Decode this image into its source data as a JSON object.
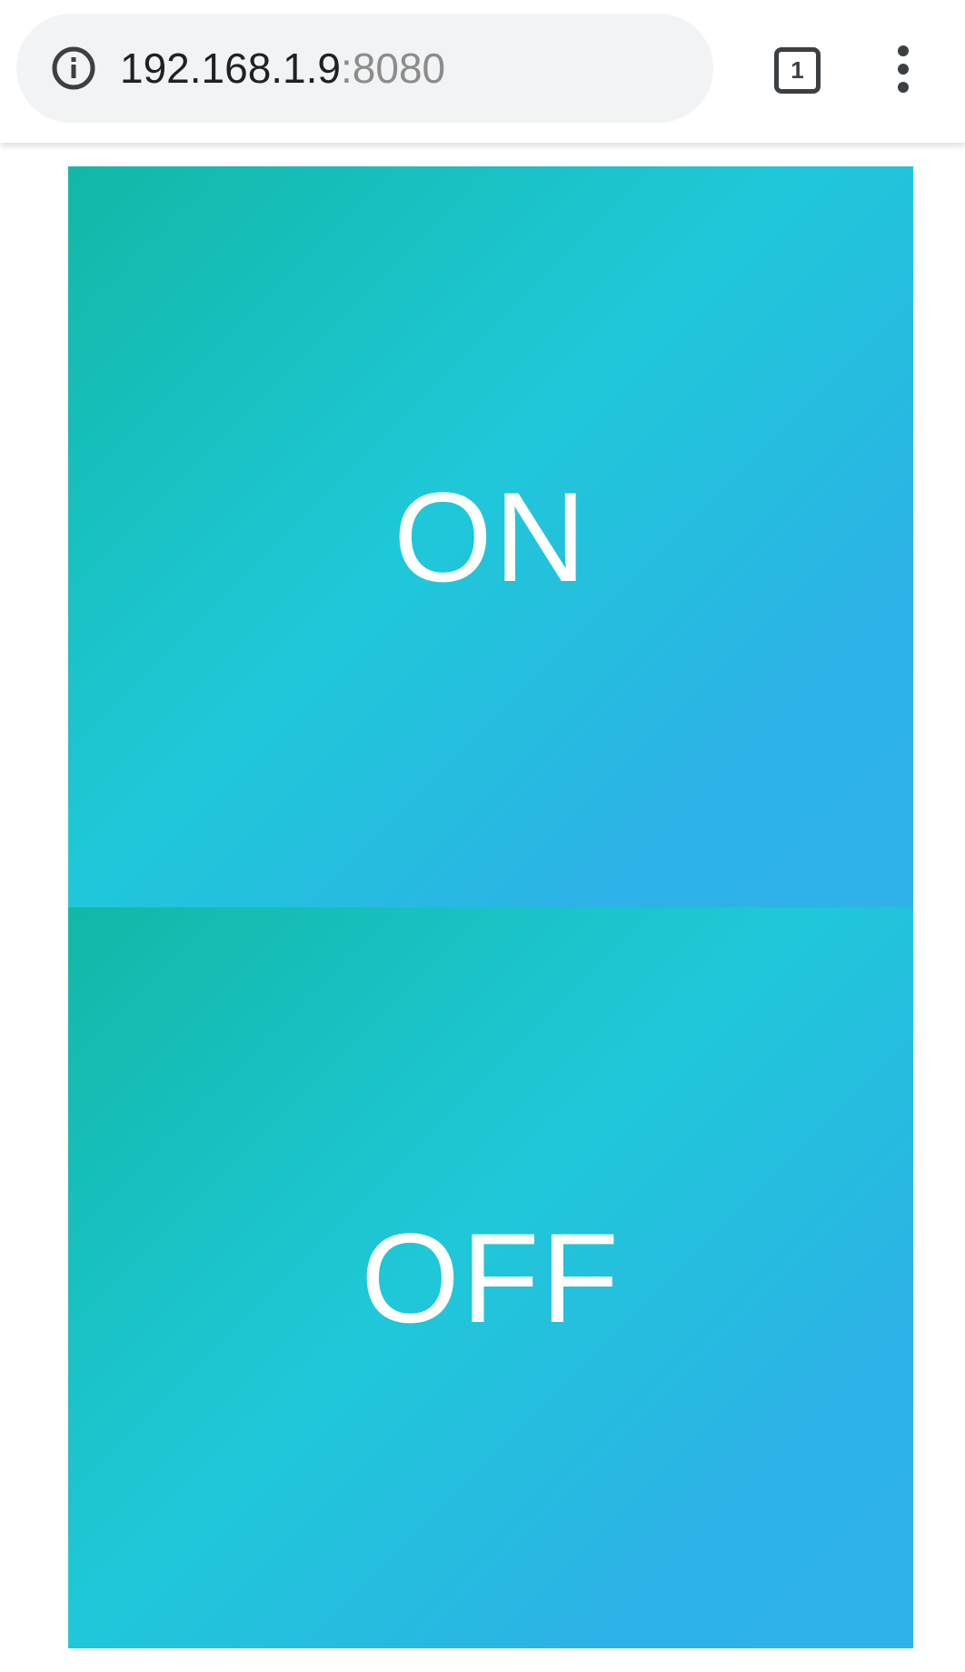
{
  "browser": {
    "url_host": "192.168.1.9",
    "url_port": ":8080",
    "tab_count": "1",
    "icons": {
      "info": "info-icon",
      "tabs": "tab-switcher-icon",
      "menu": "more-vert-icon"
    }
  },
  "page": {
    "on_label": "ON",
    "off_label": "OFF",
    "colors": {
      "gradient_start": "#11b8a6",
      "gradient_mid": "#1fc8d8",
      "gradient_end": "#2fb2e9",
      "text": "#ffffff"
    }
  }
}
